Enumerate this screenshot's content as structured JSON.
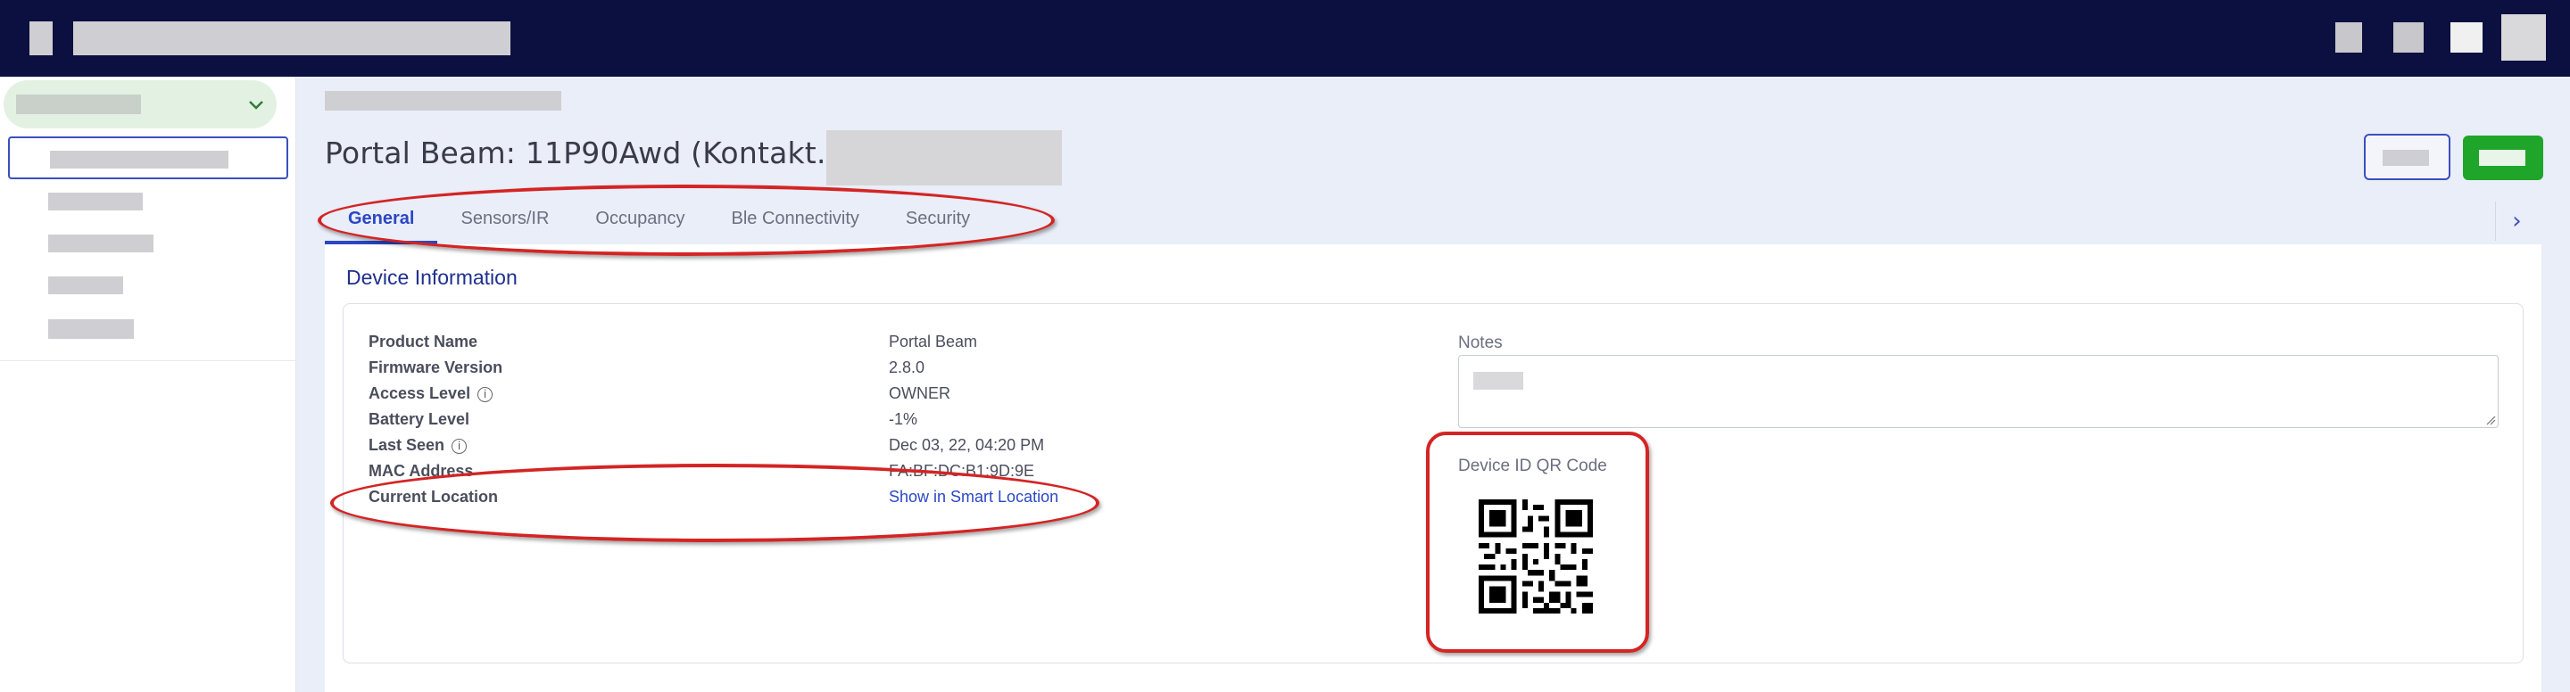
{
  "app": {
    "device_title": "Portal Beam: 11P90Awd (Kontakt.io)"
  },
  "tabs": [
    {
      "label": "General",
      "active": true
    },
    {
      "label": "Sensors/IR",
      "active": false
    },
    {
      "label": "Occupancy",
      "active": false
    },
    {
      "label": "Ble Connectivity",
      "active": false
    },
    {
      "label": "Security",
      "active": false
    }
  ],
  "section": {
    "title": "Device Information"
  },
  "fields": [
    {
      "label": "Product Name",
      "value": "Portal Beam",
      "info": false
    },
    {
      "label": "Firmware Version",
      "value": "2.8.0",
      "info": false
    },
    {
      "label": "Access Level",
      "value": "OWNER",
      "info": true
    },
    {
      "label": "Battery Level",
      "value": "-1%",
      "info": false
    },
    {
      "label": "Last Seen",
      "value": "Dec 03, 22, 04:20 PM",
      "info": true
    },
    {
      "label": "MAC Address",
      "value": "FA:BF:DC:B1:9D:9E",
      "info": false
    },
    {
      "label": "Current Location",
      "value": "Show in Smart Location",
      "info": false,
      "link": true
    }
  ],
  "notes": {
    "label": "Notes"
  },
  "qr": {
    "label": "Device ID QR Code"
  },
  "icons": {
    "info": "i",
    "chevron_right": "›"
  },
  "colors": {
    "topbar": "#0b1040",
    "accent": "#2b47c4",
    "primary_button": "#1fa52a",
    "annotation": "#d42424"
  }
}
